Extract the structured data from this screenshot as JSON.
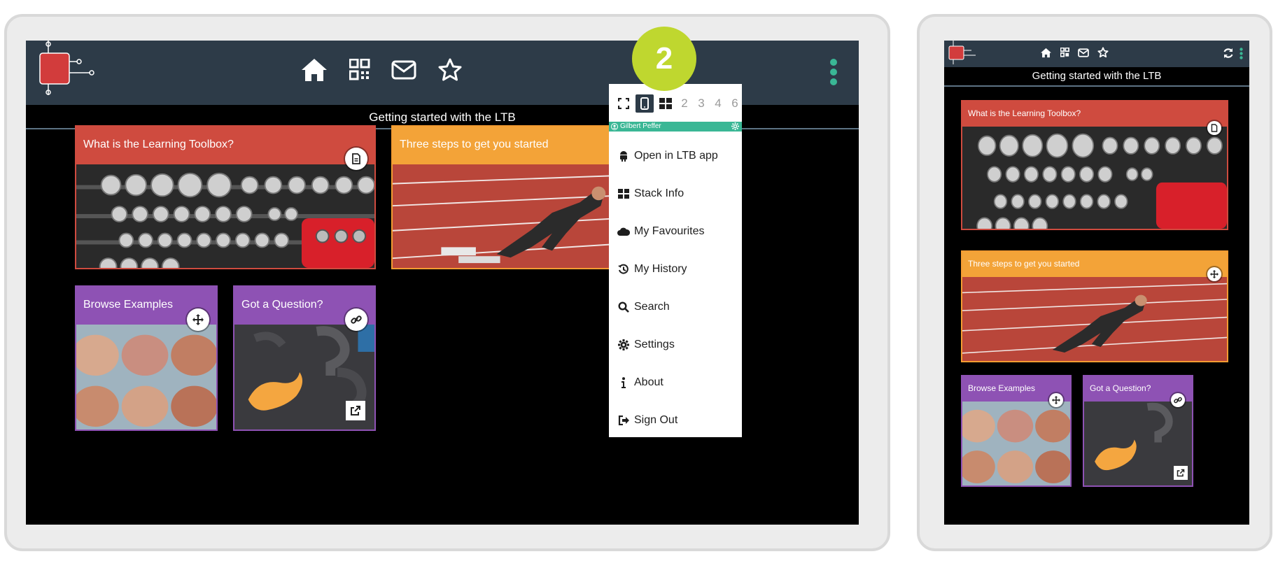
{
  "app": {
    "stack_title": "Getting started with the LTB"
  },
  "nav": {
    "icons": [
      "home-icon",
      "qr-code-icon",
      "envelope-icon",
      "star-icon"
    ]
  },
  "tiles": [
    {
      "title": "What is the Learning Toolbox?",
      "color": "#cf4b3f",
      "badge_icon": "document-icon"
    },
    {
      "title": "Three steps to get you started",
      "color": "#f3a338",
      "badge_icon": "move-icon"
    },
    {
      "title": "Browse Examples",
      "color": "#8e52b4",
      "badge_icon": "move-icon"
    },
    {
      "title": "Got a Question?",
      "color": "#8e52b4",
      "badge_icon": "link-icon"
    }
  ],
  "menu": {
    "view_numbers": [
      "2",
      "3",
      "4",
      "6"
    ],
    "user_name": "Gilbert Peffer",
    "items": [
      {
        "label": "Open in LTB app",
        "icon": "android-icon"
      },
      {
        "label": "Stack Info",
        "icon": "grid-icon"
      },
      {
        "label": "My Favourites",
        "icon": "cloud-icon"
      },
      {
        "label": "My History",
        "icon": "history-icon"
      },
      {
        "label": "Search",
        "icon": "search-icon"
      },
      {
        "label": "Settings",
        "icon": "gear-icon"
      },
      {
        "label": "About",
        "icon": "info-icon"
      },
      {
        "label": "Sign Out",
        "icon": "sign-out-icon"
      }
    ]
  },
  "step_badge": "2",
  "colors": {
    "topbar": "#2d3b48",
    "accent": "#3ab795",
    "step": "#bfd72f"
  }
}
